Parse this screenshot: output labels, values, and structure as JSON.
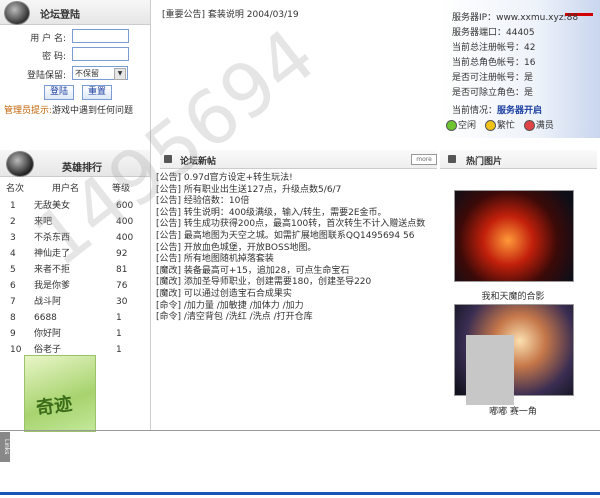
{
  "login": {
    "title": "论坛登陆",
    "username_label": "用 户 名:",
    "password_label": "密    码:",
    "keep_label": "登陆保留:",
    "keep_value": "不保留",
    "login_button": "登陆",
    "reset_button": "重置",
    "admin_label": "管理员提示:",
    "admin_text": "游戏中遇到任何问题"
  },
  "notice": {
    "text": "[重要公告] 套装说明 2004/03/19"
  },
  "server": {
    "lines": [
      "服务器IP：www.xxmu.xyz:88",
      "服务器端口：44405",
      "当前总注册帐号：42",
      "当前总角色帐号：16",
      "是否可注册帐号：是",
      "是否可除立角色：是"
    ],
    "status_label": "当前情况：",
    "status_value": "服务器开启",
    "legend": [
      {
        "label": "空闲",
        "color": "#6dc531"
      },
      {
        "label": "繁忙",
        "color": "#f0c31b"
      },
      {
        "label": "满员",
        "color": "#e04444"
      }
    ]
  },
  "ranking": {
    "title": "英雄排行",
    "col_rank": "名次",
    "col_user": "用户名",
    "col_level": "等级",
    "rows": [
      {
        "rank": "1",
        "user": "无敌美女",
        "level": "600"
      },
      {
        "rank": "2",
        "user": "来吧",
        "level": "400"
      },
      {
        "rank": "3",
        "user": "不杀东西",
        "level": "400"
      },
      {
        "rank": "4",
        "user": "神仙走了",
        "level": "92"
      },
      {
        "rank": "5",
        "user": "来者不拒",
        "level": "81"
      },
      {
        "rank": "6",
        "user": "我是你爹",
        "level": "76"
      },
      {
        "rank": "7",
        "user": "战斗阿",
        "level": "30"
      },
      {
        "rank": "8",
        "user": "6688",
        "level": "1"
      },
      {
        "rank": "9",
        "user": "你好阿",
        "level": "1"
      },
      {
        "rank": "10",
        "user": "俗老子",
        "level": "1"
      }
    ],
    "banner_text": "奇迹"
  },
  "forum": {
    "title": "论坛新帖",
    "more": "more",
    "posts": [
      "[公告] 0.97d官方设定+转生玩法!",
      "[公告] 所有职业出生送127点，升级点数5/6/7",
      "[公告] 经验倍数：10倍",
      "[公告] 转生说明：400级满级，输入/转生，需要2E金币。",
      "[公告] 转生成功获得200点，最高100转，首次转生不计入赠送点数",
      "[公告] 最高地图为天空之城。如需扩展地图联系QQ1495694 56",
      "[公告] 开放血色城堡，开放BOSS地图。",
      "[公告] 所有地图随机掉落套装",
      "[魔改] 装备最高可+15，追加28，可点生命宝石",
      "[魔改] 添加圣导师职业，创建需要180，创建圣导220",
      "[魔改] 可以通过创造宝石合成果实",
      "[命令] /加力量 /加敏捷 /加体力 /加力",
      "[命令] /清空背包 /洗红 /洗点 /打开仓库"
    ]
  },
  "hot": {
    "title": "热门图片",
    "caption1": "我和天魔的合影",
    "caption2": "嘟嘟 赛一角"
  },
  "watermark": "1495694",
  "sidebar_tab": "Links"
}
